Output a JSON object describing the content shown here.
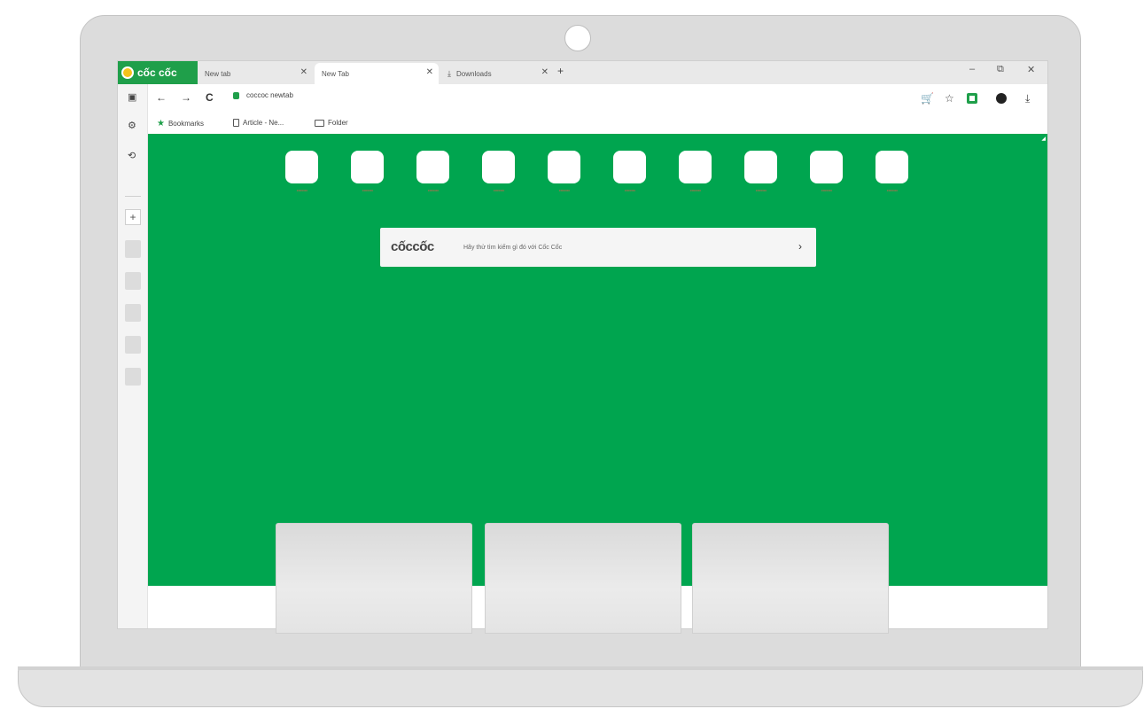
{
  "browser": {
    "brand": "cốc cốc",
    "tabs": [
      {
        "label": "New tab",
        "close": "✕"
      },
      {
        "label": "New Tab",
        "close": "✕"
      },
      {
        "label": "Downloads",
        "close": "✕"
      }
    ],
    "new_tab_symbol": "+",
    "window_controls": {
      "minimize": "–",
      "restore": "⧉",
      "close": "✕"
    }
  },
  "toolbar": {
    "back": "←",
    "forward": "→",
    "reload": "C",
    "url": "coccoc newtab",
    "cart_icon": "🛒",
    "star_icon": "☆",
    "download_icon": "⤓"
  },
  "bookmarks": [
    {
      "label": "Bookmarks"
    },
    {
      "label": "Article - Ne..."
    },
    {
      "label": "Folder"
    }
  ],
  "sidebar": {
    "icons": [
      "▣",
      "⚙",
      "⟲"
    ],
    "add_label": "+"
  },
  "speed_dial": [
    {
      "label": "coccoc"
    },
    {
      "label": "coccoc"
    },
    {
      "label": "coccoc"
    },
    {
      "label": "coccoc"
    },
    {
      "label": "coccoc"
    },
    {
      "label": "coccoc"
    },
    {
      "label": "coccoc"
    },
    {
      "label": "coccoc"
    },
    {
      "label": "coccoc"
    },
    {
      "label": "coccoc"
    }
  ],
  "search": {
    "logo": "cốccốc",
    "placeholder": "Hãy thử tìm kiếm gì đó với Cốc Cốc",
    "arrow": "›"
  },
  "colors": {
    "accent_green": "#00a54f",
    "brand_green": "#1f9f4a",
    "tile_label": "#e85c4f"
  }
}
